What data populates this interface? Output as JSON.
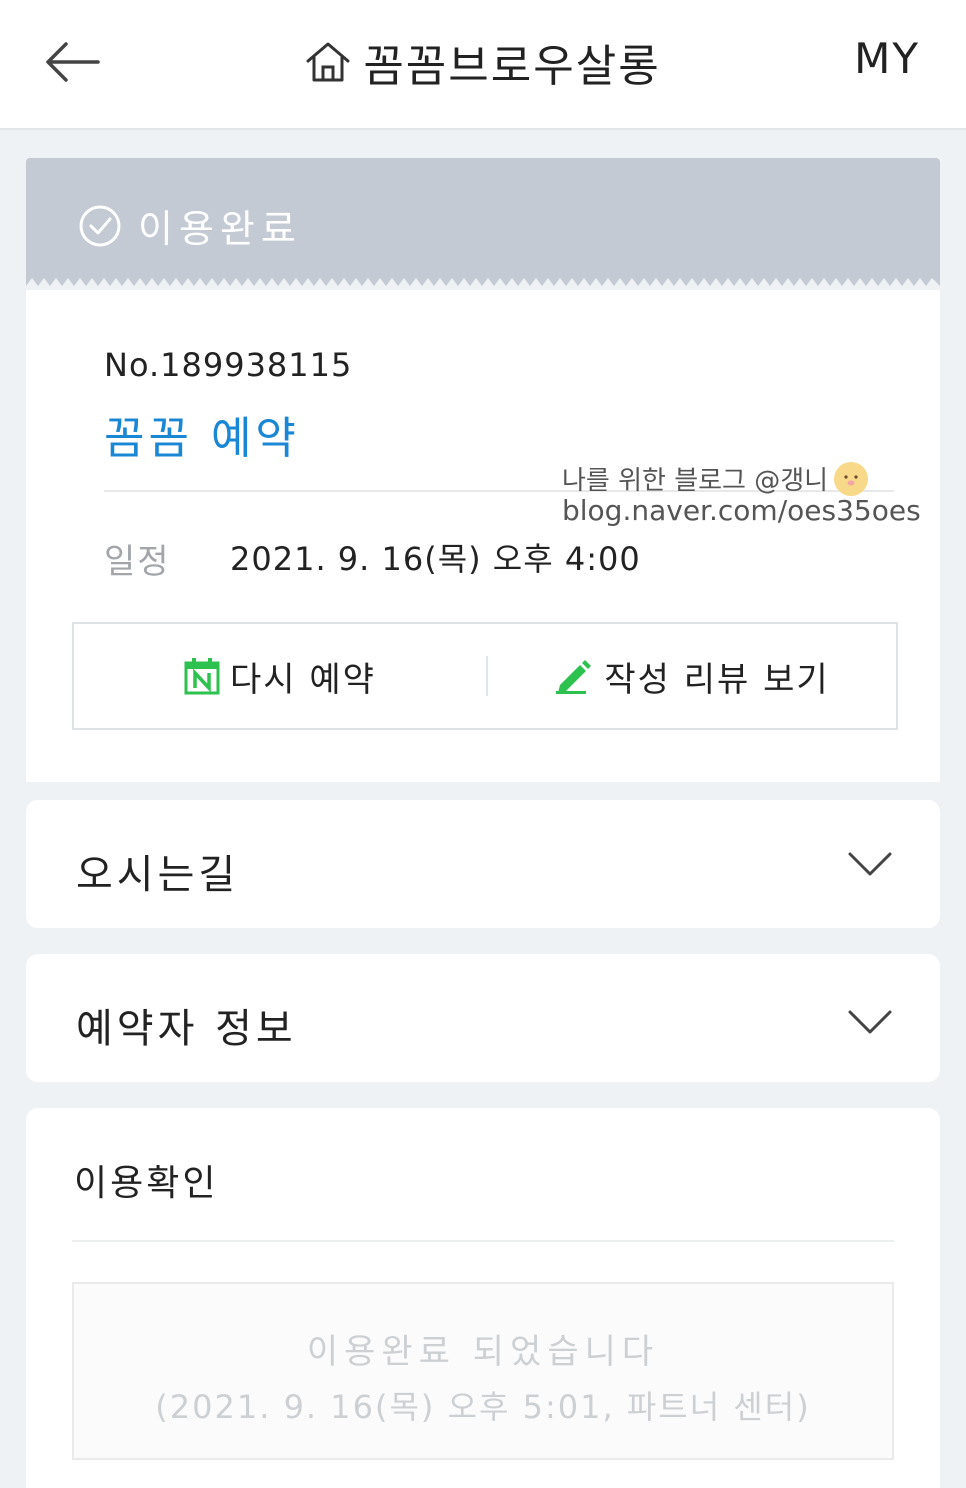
{
  "header": {
    "back_icon": "arrow-left-icon",
    "home_icon": "home-icon",
    "title": "꼼꼼브로우살롱",
    "my_label": "MY"
  },
  "status": {
    "icon": "check-circle-icon",
    "label": "이용완료",
    "banner_color": "#c3cad3"
  },
  "reservation": {
    "number": "No.189938115",
    "type": "꼼꼼 예약",
    "type_color": "#1a87d4",
    "watermark_line1": "나를 위한 블로그 @갱니",
    "watermark_line2": "blog.naver.com/oes35oes",
    "schedule_label": "일정",
    "schedule_value": "2021. 9. 16(목) 오후 4:00",
    "actions": [
      {
        "icon": "naver-calendar-icon",
        "label": "다시 예약"
      },
      {
        "icon": "pencil-icon",
        "label": "작성 리뷰 보기"
      }
    ],
    "accent_green": "#2dc24f"
  },
  "sections": {
    "directions": {
      "title": "오시는길",
      "icon": "chevron-down-icon"
    },
    "booker_info": {
      "title": "예약자 정보",
      "icon": "chevron-down-icon"
    }
  },
  "confirmation": {
    "title": "이용확인",
    "message": "이용완료 되었습니다",
    "detail": "(2021. 9. 16(목) 오후 5:01, 파트너 센터)"
  }
}
